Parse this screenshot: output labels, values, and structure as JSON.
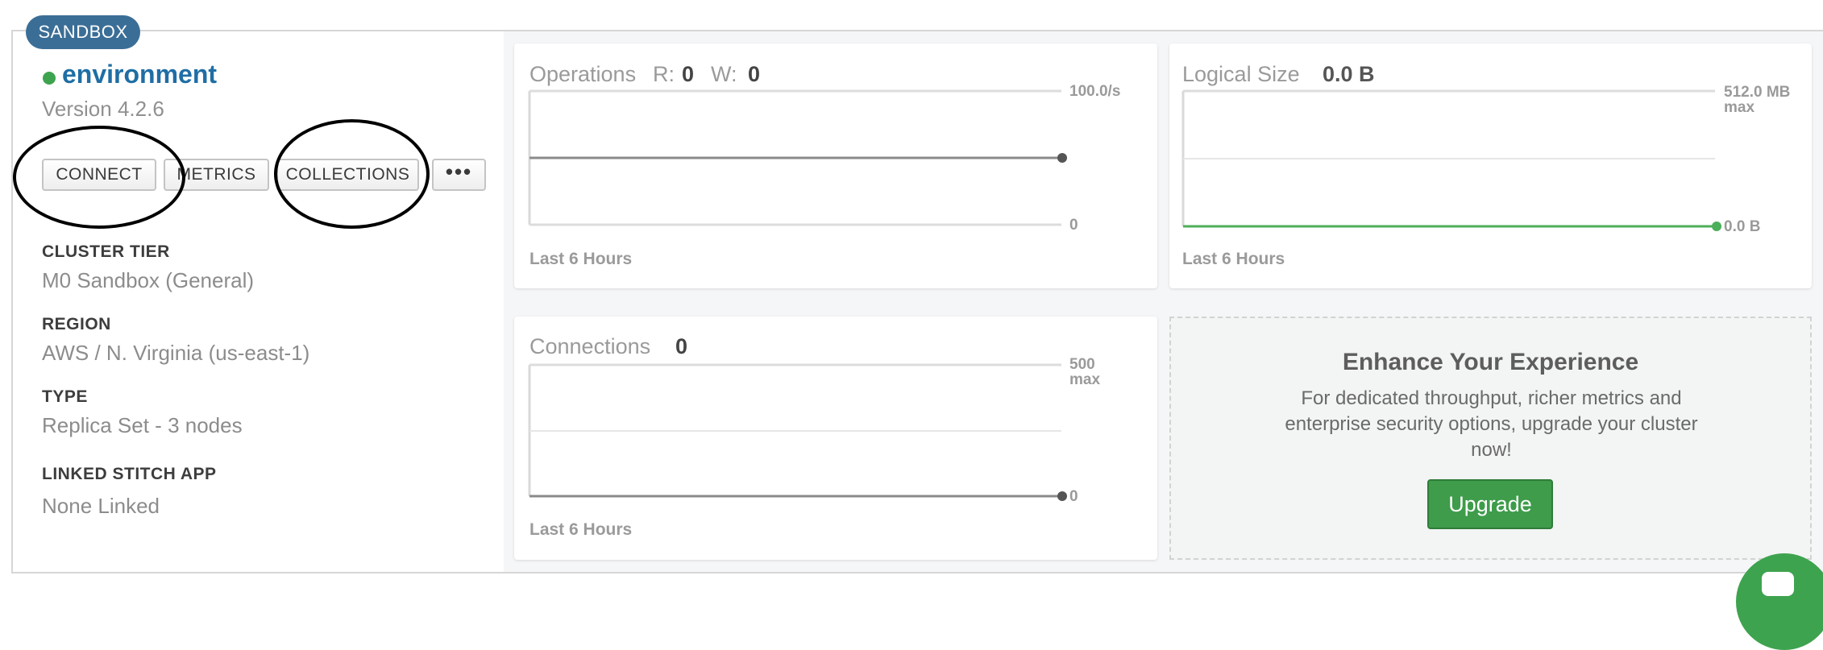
{
  "badge": "SANDBOX",
  "cluster": {
    "name": "environment",
    "version": "Version 4.2.6",
    "status_color": "#3ea34e"
  },
  "buttons": {
    "connect": "CONNECT",
    "metrics": "METRICS",
    "collections": "COLLECTIONS",
    "more": "•••"
  },
  "info": {
    "tier_label": "CLUSTER TIER",
    "tier_value": "M0 Sandbox (General)",
    "region_label": "REGION",
    "region_value": "AWS / N. Virginia (us-east-1)",
    "type_label": "TYPE",
    "type_value": "Replica Set - 3 nodes",
    "stitch_label": "LINKED STITCH APP",
    "stitch_value": "None Linked"
  },
  "operations": {
    "title": "Operations",
    "r_label": "R:",
    "r_value": "0",
    "w_label": "W:",
    "w_value": "0",
    "scale_max": "100.0/s",
    "scale_min": "0",
    "footer": "Last 6 Hours"
  },
  "logical_size": {
    "title": "Logical Size",
    "value": "0.0 B",
    "scale_max": "512.0 MB",
    "scale_max_sub": "max",
    "scale_current": "0.0 B",
    "footer": "Last 6 Hours"
  },
  "connections": {
    "title": "Connections",
    "value": "0",
    "scale_max": "500",
    "scale_max_sub": "max",
    "scale_current": "0",
    "footer": "Last 6 Hours"
  },
  "promo": {
    "title": "Enhance Your Experience",
    "text": "For dedicated throughput, richer metrics and enterprise security options, upgrade your cluster now!",
    "button": "Upgrade"
  },
  "colors": {
    "badge": "#3b6e96",
    "link": "#1f6ea5",
    "upgrade": "#3e9c4b"
  }
}
